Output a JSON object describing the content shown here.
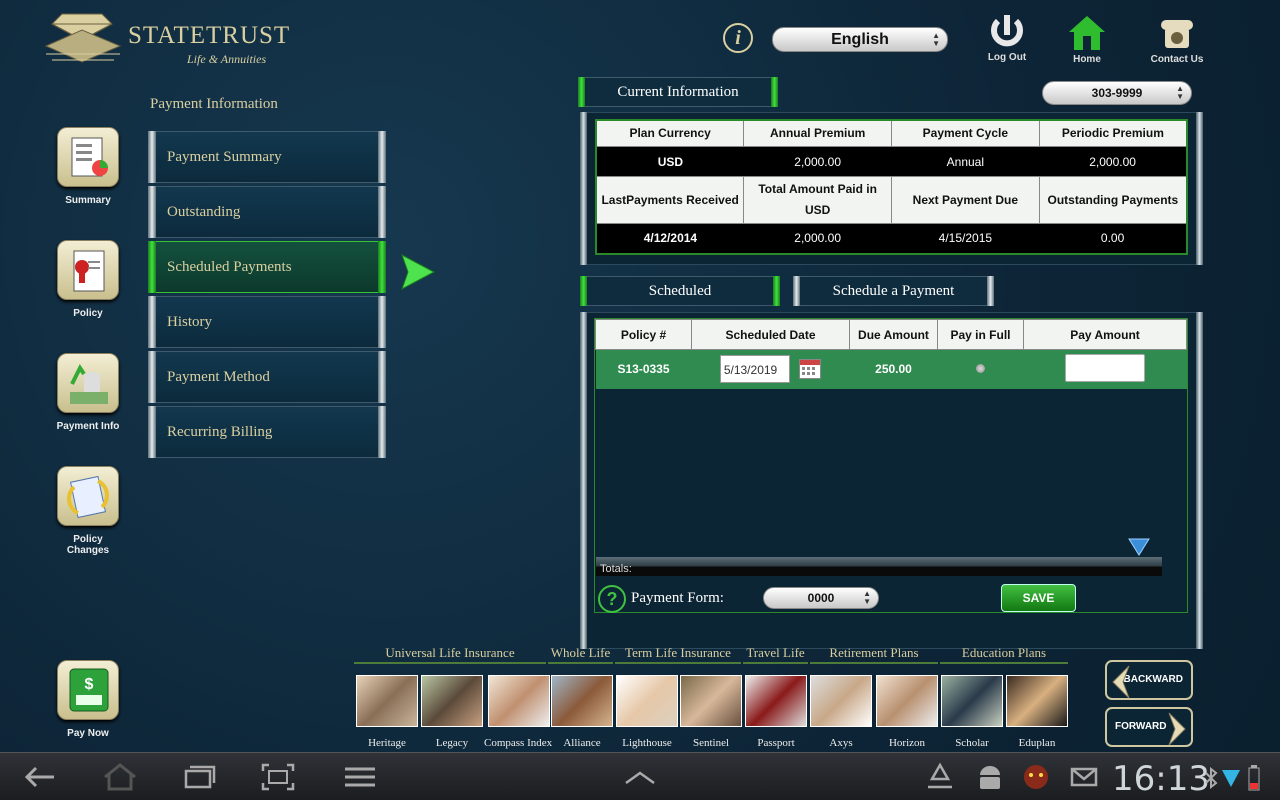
{
  "app": {
    "brand": "StateTrust",
    "tagline": "Life & Annuities"
  },
  "header": {
    "language": "English",
    "logout_label": "Log Out",
    "home_label": "Home",
    "contact_label": "Contact Us"
  },
  "left_nav": [
    {
      "label": "Summary",
      "icon": "summary-icon"
    },
    {
      "label": "Policy",
      "icon": "policy-certificate-icon"
    },
    {
      "label": "Payment Info",
      "icon": "payment-info-icon"
    },
    {
      "label": "Policy Changes",
      "icon": "policy-changes-icon"
    }
  ],
  "pay_now_label": "Pay Now",
  "payment_menu": {
    "title": "Payment Information",
    "items": [
      "Payment Summary",
      "Outstanding",
      "Scheduled Payments",
      "History",
      "Payment Method",
      "Recurring Billing"
    ],
    "active": "Scheduled Payments"
  },
  "current_info": {
    "tab_label": "Current Information",
    "policy_selected": "303-9999",
    "row1_headers": [
      "Plan Currency",
      "Annual Premium",
      "Payment Cycle",
      "Periodic Premium"
    ],
    "row1_values": [
      "USD",
      "2,000.00",
      "Annual",
      "2,000.00"
    ],
    "row2_headers": [
      "LastPayments Received",
      "Total Amount Paid in USD",
      "Next Payment Due",
      "Outstanding Payments"
    ],
    "row2_values": [
      "4/12/2014",
      "2,000.00",
      "4/15/2015",
      "0.00"
    ]
  },
  "scheduled": {
    "tab_scheduled": "Scheduled",
    "tab_schedule_payment": "Schedule a Payment",
    "headers": [
      "Policy #",
      "Scheduled Date",
      "Due Amount",
      "Pay in Full",
      "Pay Amount"
    ],
    "rows": [
      {
        "policy": "S13-0335",
        "date": "5/13/2019",
        "due": "250.00",
        "pay_amount": ""
      }
    ],
    "totals_label": "Totals:",
    "payment_form_label": "Payment Form:",
    "payment_form_value": "0000",
    "save_label": "SAVE"
  },
  "products": {
    "categories": [
      "Universal Life Insurance",
      "Whole Life",
      "Term Life Insurance",
      "Travel Life",
      "Retirement Plans",
      "Education Plans"
    ],
    "items": [
      "Heritage",
      "Legacy",
      "Compass Index",
      "Alliance",
      "Lighthouse",
      "Sentinel",
      "Passport",
      "Axys",
      "Horizon",
      "Scholar",
      "Eduplan"
    ]
  },
  "nav_buttons": {
    "backward": "BACKWARD",
    "forward": "FORWARD"
  },
  "system_bar": {
    "time": "16:13"
  },
  "colors": {
    "accent_green": "#3fe23f",
    "gold_text": "#d9cfa0",
    "row_green": "#2f8b4f",
    "background": "#0f2a3d"
  }
}
